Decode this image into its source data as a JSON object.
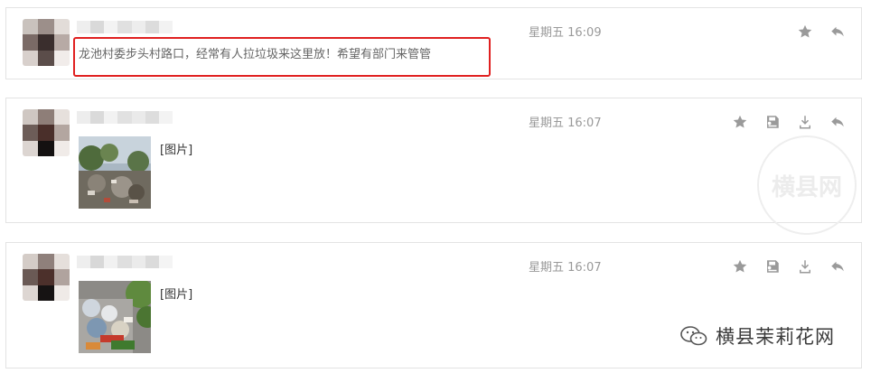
{
  "messages": [
    {
      "time": "星期五 16:09",
      "text": "龙池村委步头村路口，经常有人拉垃圾来这里放！希望有部门来管管"
    },
    {
      "time": "星期五 16:07",
      "attachment_label": "[图片]"
    },
    {
      "time": "星期五 16:07",
      "attachment_label": "[图片]"
    }
  ],
  "icons": {
    "star": "star-icon",
    "save": "save-icon",
    "download": "download-icon",
    "reply": "reply-icon"
  },
  "watermark": "横县网",
  "brand": "横县茉莉花网",
  "colors": {
    "highlight": "#e02020",
    "icon": "#9a9a9a",
    "timestamp": "#999999"
  }
}
